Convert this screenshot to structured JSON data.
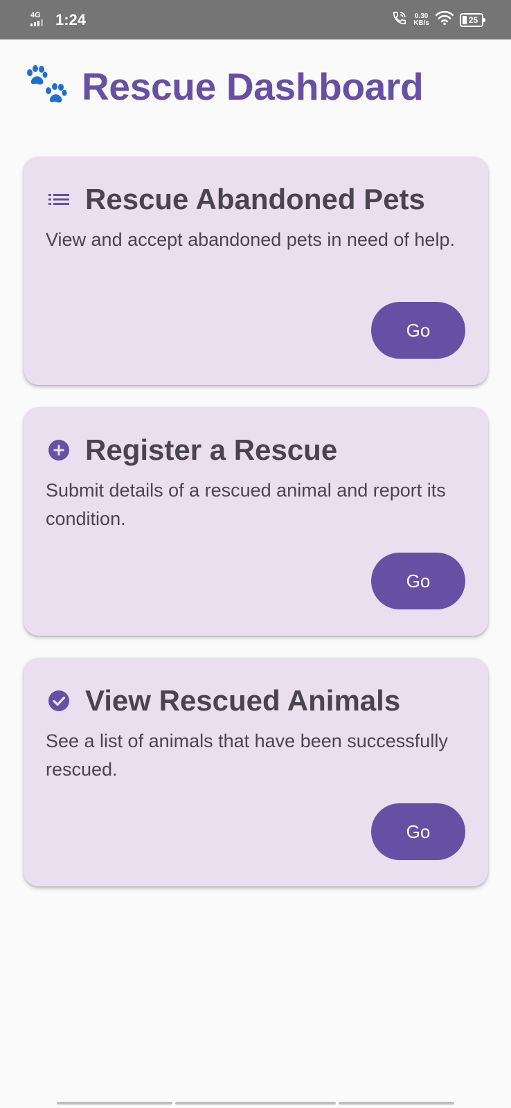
{
  "status_bar": {
    "network": "4G",
    "time": "1:24",
    "speed_value": "0.30",
    "speed_unit": "KB/s",
    "battery": "25",
    "icons": [
      "signal-icon",
      "wifi-calling-icon",
      "wifi-icon",
      "battery-icon"
    ]
  },
  "header": {
    "title": "Rescue Dashboard",
    "icon": "paw-icon",
    "title_color": "#6750a4",
    "icon_color": "#1f6fd1"
  },
  "cards": [
    {
      "icon": "list-icon",
      "title": "Rescue Abandoned Pets",
      "description": "View and accept abandoned pets in need of help.",
      "button": "Go"
    },
    {
      "icon": "add-circle-icon",
      "title": "Register a Rescue",
      "description": "Submit details of a rescued animal and report its condition.",
      "button": "Go"
    },
    {
      "icon": "check-circle-icon",
      "title": "View Rescued Animals",
      "description": "See a list of animals that have been successfully rescued.",
      "button": "Go"
    }
  ],
  "colors": {
    "accent": "#6750a4",
    "card_background": "#e9dfee",
    "text": "#49454f",
    "page_background": "#fafafa",
    "status_bar": "#757575"
  }
}
